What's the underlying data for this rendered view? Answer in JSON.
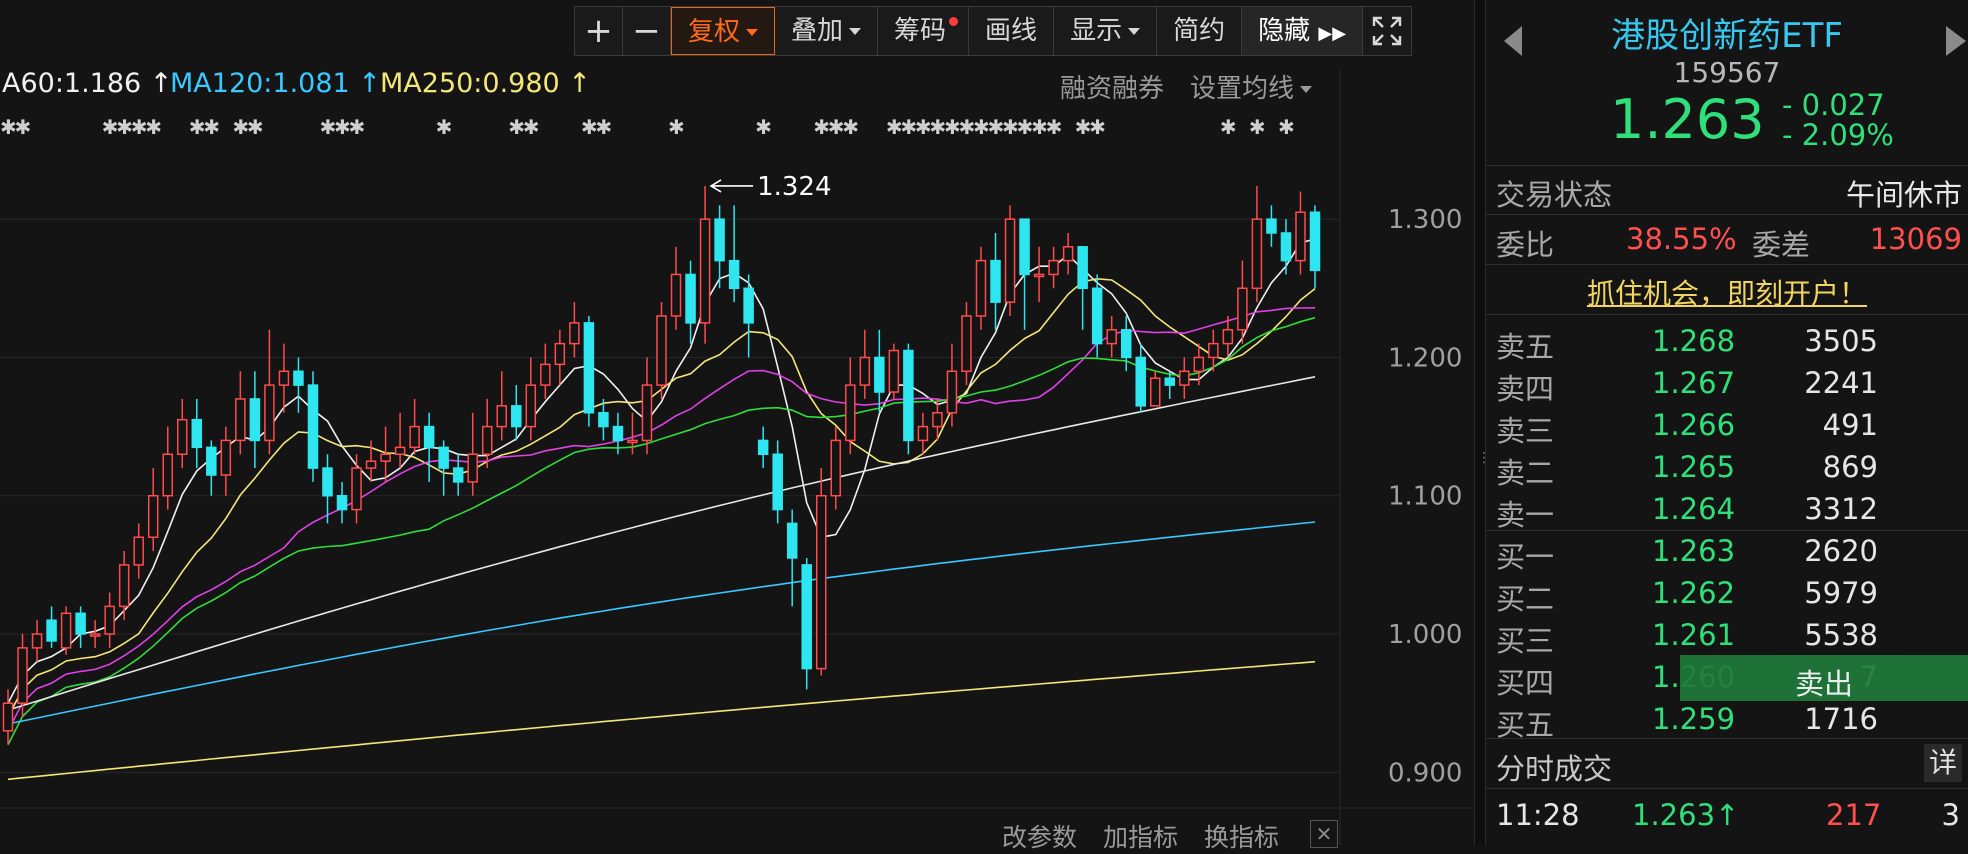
{
  "toolbar": {
    "zoom_in_icon": "+",
    "zoom_out_icon": "−",
    "items": [
      "复权",
      "叠加",
      "筹码",
      "画线",
      "显示",
      "简约",
      "隐藏"
    ],
    "fullscreen_icon": "fullscreen-icon"
  },
  "ma_legend": [
    {
      "label": "A60:1.186 ↑",
      "color": "#f0f0f0"
    },
    {
      "label": "MA120:1.081 ↑",
      "color": "#39c8ff"
    },
    {
      "label": "MA250:0.980 ↑",
      "color": "#f5e67a"
    }
  ],
  "chart_links": {
    "margin": "融资融券",
    "ma_settings": "设置均线"
  },
  "bottom_links": {
    "change_params": "改参数",
    "add_indicator": "加指标",
    "swap_indicator": "换指标"
  },
  "chart_data": {
    "type": "candlestick",
    "ylim": [
      0.88,
      1.35
    ],
    "y_ticks": [
      "1.300",
      "1.200",
      "1.100",
      "1.000",
      "0.900"
    ],
    "y_tick_values": [
      1.3,
      1.2,
      1.1,
      1.0,
      0.9
    ],
    "max_label": "1.324",
    "max_value": 1.324,
    "colors": {
      "up": "#ff4b4b",
      "down": "#2ee6f0",
      "ma5": "#f0f0f0",
      "ma10": "#f5e67a",
      "ma20": "#e040e8",
      "ma30": "#2fdc3a",
      "ma60": "#e8e8e8",
      "ma120": "#39c8ff",
      "ma250": "#f5e67a"
    },
    "candles": [
      [
        0.93,
        0.95,
        0.96,
        0.92
      ],
      [
        0.95,
        0.99,
        1.0,
        0.94
      ],
      [
        0.99,
        1.0,
        1.01,
        0.98
      ],
      [
        1.01,
        0.995,
        1.02,
        0.99
      ],
      [
        0.99,
        1.015,
        1.02,
        0.985
      ],
      [
        1.015,
        1.0,
        1.02,
        0.99
      ],
      [
        1.0,
        1.0,
        1.01,
        0.99
      ],
      [
        1.0,
        1.02,
        1.03,
        0.99
      ],
      [
        1.02,
        1.05,
        1.06,
        1.01
      ],
      [
        1.05,
        1.07,
        1.08,
        1.04
      ],
      [
        1.07,
        1.1,
        1.12,
        1.06
      ],
      [
        1.1,
        1.13,
        1.15,
        1.09
      ],
      [
        1.13,
        1.155,
        1.17,
        1.12
      ],
      [
        1.155,
        1.135,
        1.17,
        1.12
      ],
      [
        1.135,
        1.115,
        1.14,
        1.1
      ],
      [
        1.115,
        1.14,
        1.15,
        1.1
      ],
      [
        1.14,
        1.17,
        1.19,
        1.13
      ],
      [
        1.17,
        1.14,
        1.19,
        1.12
      ],
      [
        1.14,
        1.18,
        1.22,
        1.13
      ],
      [
        1.18,
        1.19,
        1.21,
        1.16
      ],
      [
        1.19,
        1.18,
        1.2,
        1.16
      ],
      [
        1.18,
        1.12,
        1.19,
        1.11
      ],
      [
        1.12,
        1.1,
        1.13,
        1.08
      ],
      [
        1.1,
        1.09,
        1.11,
        1.08
      ],
      [
        1.09,
        1.12,
        1.13,
        1.08
      ],
      [
        1.12,
        1.125,
        1.14,
        1.11
      ],
      [
        1.125,
        1.13,
        1.15,
        1.11
      ],
      [
        1.13,
        1.135,
        1.16,
        1.12
      ],
      [
        1.135,
        1.15,
        1.17,
        1.13
      ],
      [
        1.15,
        1.135,
        1.16,
        1.11
      ],
      [
        1.135,
        1.12,
        1.14,
        1.1
      ],
      [
        1.12,
        1.11,
        1.13,
        1.1
      ],
      [
        1.11,
        1.13,
        1.16,
        1.1
      ],
      [
        1.13,
        1.15,
        1.17,
        1.12
      ],
      [
        1.15,
        1.165,
        1.19,
        1.14
      ],
      [
        1.165,
        1.15,
        1.18,
        1.14
      ],
      [
        1.15,
        1.18,
        1.2,
        1.14
      ],
      [
        1.18,
        1.195,
        1.21,
        1.17
      ],
      [
        1.195,
        1.21,
        1.22,
        1.18
      ],
      [
        1.21,
        1.225,
        1.24,
        1.2
      ],
      [
        1.225,
        1.16,
        1.23,
        1.15
      ],
      [
        1.16,
        1.15,
        1.17,
        1.14
      ],
      [
        1.15,
        1.14,
        1.16,
        1.13
      ],
      [
        1.14,
        1.14,
        1.16,
        1.13
      ],
      [
        1.14,
        1.18,
        1.2,
        1.13
      ],
      [
        1.18,
        1.23,
        1.24,
        1.17
      ],
      [
        1.23,
        1.26,
        1.28,
        1.22
      ],
      [
        1.26,
        1.225,
        1.27,
        1.21
      ],
      [
        1.225,
        1.3,
        1.324,
        1.21
      ],
      [
        1.3,
        1.27,
        1.31,
        1.25
      ],
      [
        1.27,
        1.25,
        1.31,
        1.24
      ],
      [
        1.25,
        1.225,
        1.26,
        1.2
      ],
      [
        1.14,
        1.13,
        1.15,
        1.12
      ],
      [
        1.13,
        1.09,
        1.14,
        1.08
      ],
      [
        1.08,
        1.055,
        1.09,
        1.02
      ],
      [
        1.05,
        0.975,
        1.055,
        0.96
      ],
      [
        0.975,
        1.1,
        1.12,
        0.97
      ],
      [
        1.1,
        1.14,
        1.15,
        1.09
      ],
      [
        1.14,
        1.18,
        1.2,
        1.13
      ],
      [
        1.18,
        1.2,
        1.22,
        1.17
      ],
      [
        1.2,
        1.175,
        1.22,
        1.16
      ],
      [
        1.175,
        1.205,
        1.21,
        1.17
      ],
      [
        1.205,
        1.14,
        1.21,
        1.13
      ],
      [
        1.14,
        1.15,
        1.16,
        1.13
      ],
      [
        1.15,
        1.16,
        1.17,
        1.14
      ],
      [
        1.16,
        1.19,
        1.21,
        1.15
      ],
      [
        1.19,
        1.23,
        1.24,
        1.18
      ],
      [
        1.23,
        1.27,
        1.28,
        1.22
      ],
      [
        1.27,
        1.24,
        1.29,
        1.22
      ],
      [
        1.24,
        1.3,
        1.31,
        1.23
      ],
      [
        1.3,
        1.26,
        1.3,
        1.22
      ],
      [
        1.26,
        1.26,
        1.28,
        1.24
      ],
      [
        1.26,
        1.27,
        1.28,
        1.25
      ],
      [
        1.27,
        1.28,
        1.29,
        1.26
      ],
      [
        1.28,
        1.25,
        1.28,
        1.22
      ],
      [
        1.25,
        1.21,
        1.26,
        1.2
      ],
      [
        1.21,
        1.22,
        1.23,
        1.2
      ],
      [
        1.22,
        1.2,
        1.23,
        1.19
      ],
      [
        1.2,
        1.165,
        1.21,
        1.16
      ],
      [
        1.165,
        1.185,
        1.19,
        1.17
      ],
      [
        1.185,
        1.18,
        1.19,
        1.17
      ],
      [
        1.18,
        1.19,
        1.2,
        1.17
      ],
      [
        1.19,
        1.2,
        1.21,
        1.18
      ],
      [
        1.2,
        1.21,
        1.22,
        1.19
      ],
      [
        1.21,
        1.22,
        1.23,
        1.2
      ],
      [
        1.22,
        1.25,
        1.27,
        1.21
      ],
      [
        1.25,
        1.3,
        1.324,
        1.24
      ],
      [
        1.3,
        1.29,
        1.31,
        1.28
      ],
      [
        1.29,
        1.27,
        1.3,
        1.26
      ],
      [
        1.27,
        1.305,
        1.32,
        1.26
      ],
      [
        1.305,
        1.263,
        1.31,
        1.25
      ]
    ],
    "marker_text": "✱"
  },
  "quote": {
    "name": "港股创新药ETF",
    "code": "159567",
    "price": "1.263",
    "change": "- 0.027",
    "change_pct": "- 2.09%",
    "trade_status_label": "交易状态",
    "trade_status_value": "午间休市",
    "ratio_label": "委比",
    "ratio_value": "38.55%",
    "diff_label": "委差",
    "diff_value": "13069",
    "promo": "抓住机会，即刻开户！"
  },
  "order_book": {
    "asks": [
      {
        "label": "卖五",
        "price": "1.268",
        "vol": "3505"
      },
      {
        "label": "卖四",
        "price": "1.267",
        "vol": "2241"
      },
      {
        "label": "卖三",
        "price": "1.266",
        "vol": "491"
      },
      {
        "label": "卖二",
        "price": "1.265",
        "vol": "869"
      },
      {
        "label": "卖一",
        "price": "1.264",
        "vol": "3312"
      }
    ],
    "bids": [
      {
        "label": "买一",
        "price": "1.263",
        "vol": "2620"
      },
      {
        "label": "买二",
        "price": "1.262",
        "vol": "5979"
      },
      {
        "label": "买三",
        "price": "1.261",
        "vol": "5538"
      },
      {
        "label": "买四",
        "price": "1.260",
        "vol": "7"
      },
      {
        "label": "买五",
        "price": "1.259",
        "vol": "1716"
      }
    ],
    "sell_button": "卖出"
  },
  "ticks": {
    "title": "分时成交",
    "detail": "详",
    "rows": [
      {
        "time": "11:28",
        "price": "1.263↑",
        "vol": "217",
        "count": "3"
      }
    ]
  },
  "nav": {
    "prev_icon": "prev-triangle-icon",
    "next_icon": "next-triangle-icon"
  }
}
